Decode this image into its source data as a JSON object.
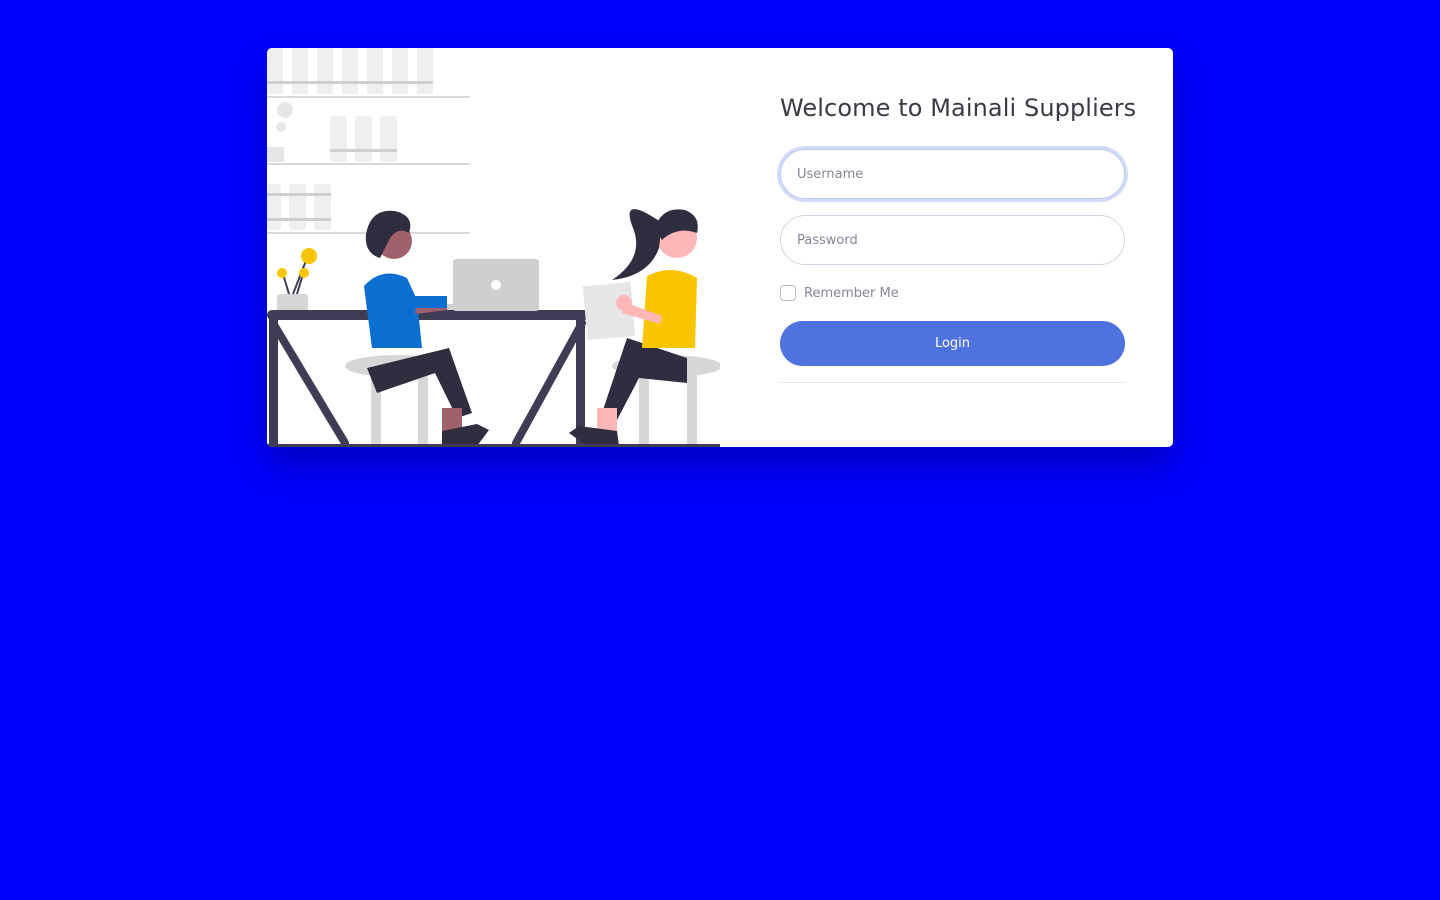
{
  "login": {
    "title": "Welcome to Mainali Suppliers",
    "username_placeholder": "Username",
    "password_placeholder": "Password",
    "remember_label": "Remember Me",
    "login_label": "Login",
    "remember_checked": false
  },
  "colors": {
    "background": "#0000ff",
    "primary": "#4e73df",
    "card": "#ffffff",
    "accent_yellow": "#f9c500",
    "accent_blue": "#0a6fd1",
    "dark": "#2f2e41"
  }
}
